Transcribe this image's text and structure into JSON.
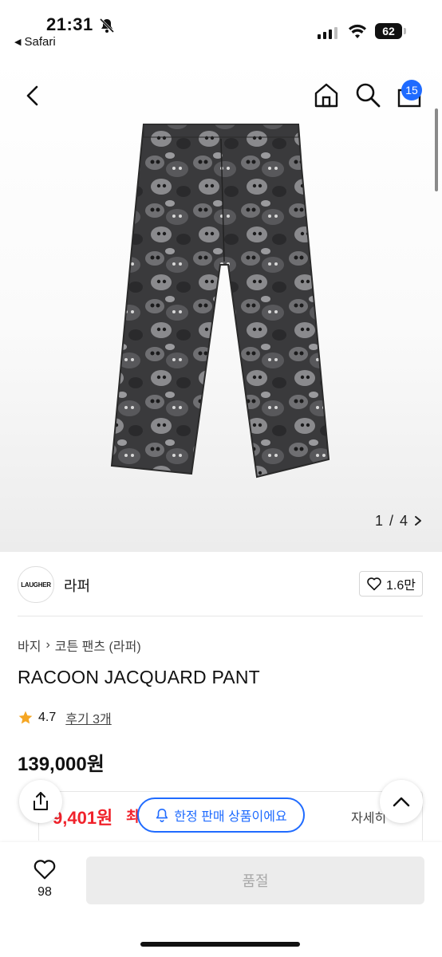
{
  "status_bar": {
    "time": "21:31",
    "back_app": "Safari",
    "battery": "62"
  },
  "nav": {
    "cart_count": "15"
  },
  "gallery": {
    "current": "1",
    "total": "4",
    "separator": "/"
  },
  "brand": {
    "logo_text": "LAUGHER",
    "name": "라퍼",
    "likes": "1.6만"
  },
  "product": {
    "breadcrumb": [
      "바지",
      "코튼 팬츠 (라퍼)"
    ],
    "title": "RACOON JACQUARD PANT",
    "rating": "4.7",
    "review_label": "후기 3개",
    "price": "139,000원"
  },
  "coupon": {
    "price": "9,401원",
    "suffix": "최",
    "detail": "자세히"
  },
  "notice": {
    "limited_label": "한정 판매 상품이에요"
  },
  "bottom": {
    "wish_count": "98",
    "soldout_label": "품절"
  },
  "colors": {
    "accent": "#1f6bff",
    "sale_red": "#f0222b"
  }
}
